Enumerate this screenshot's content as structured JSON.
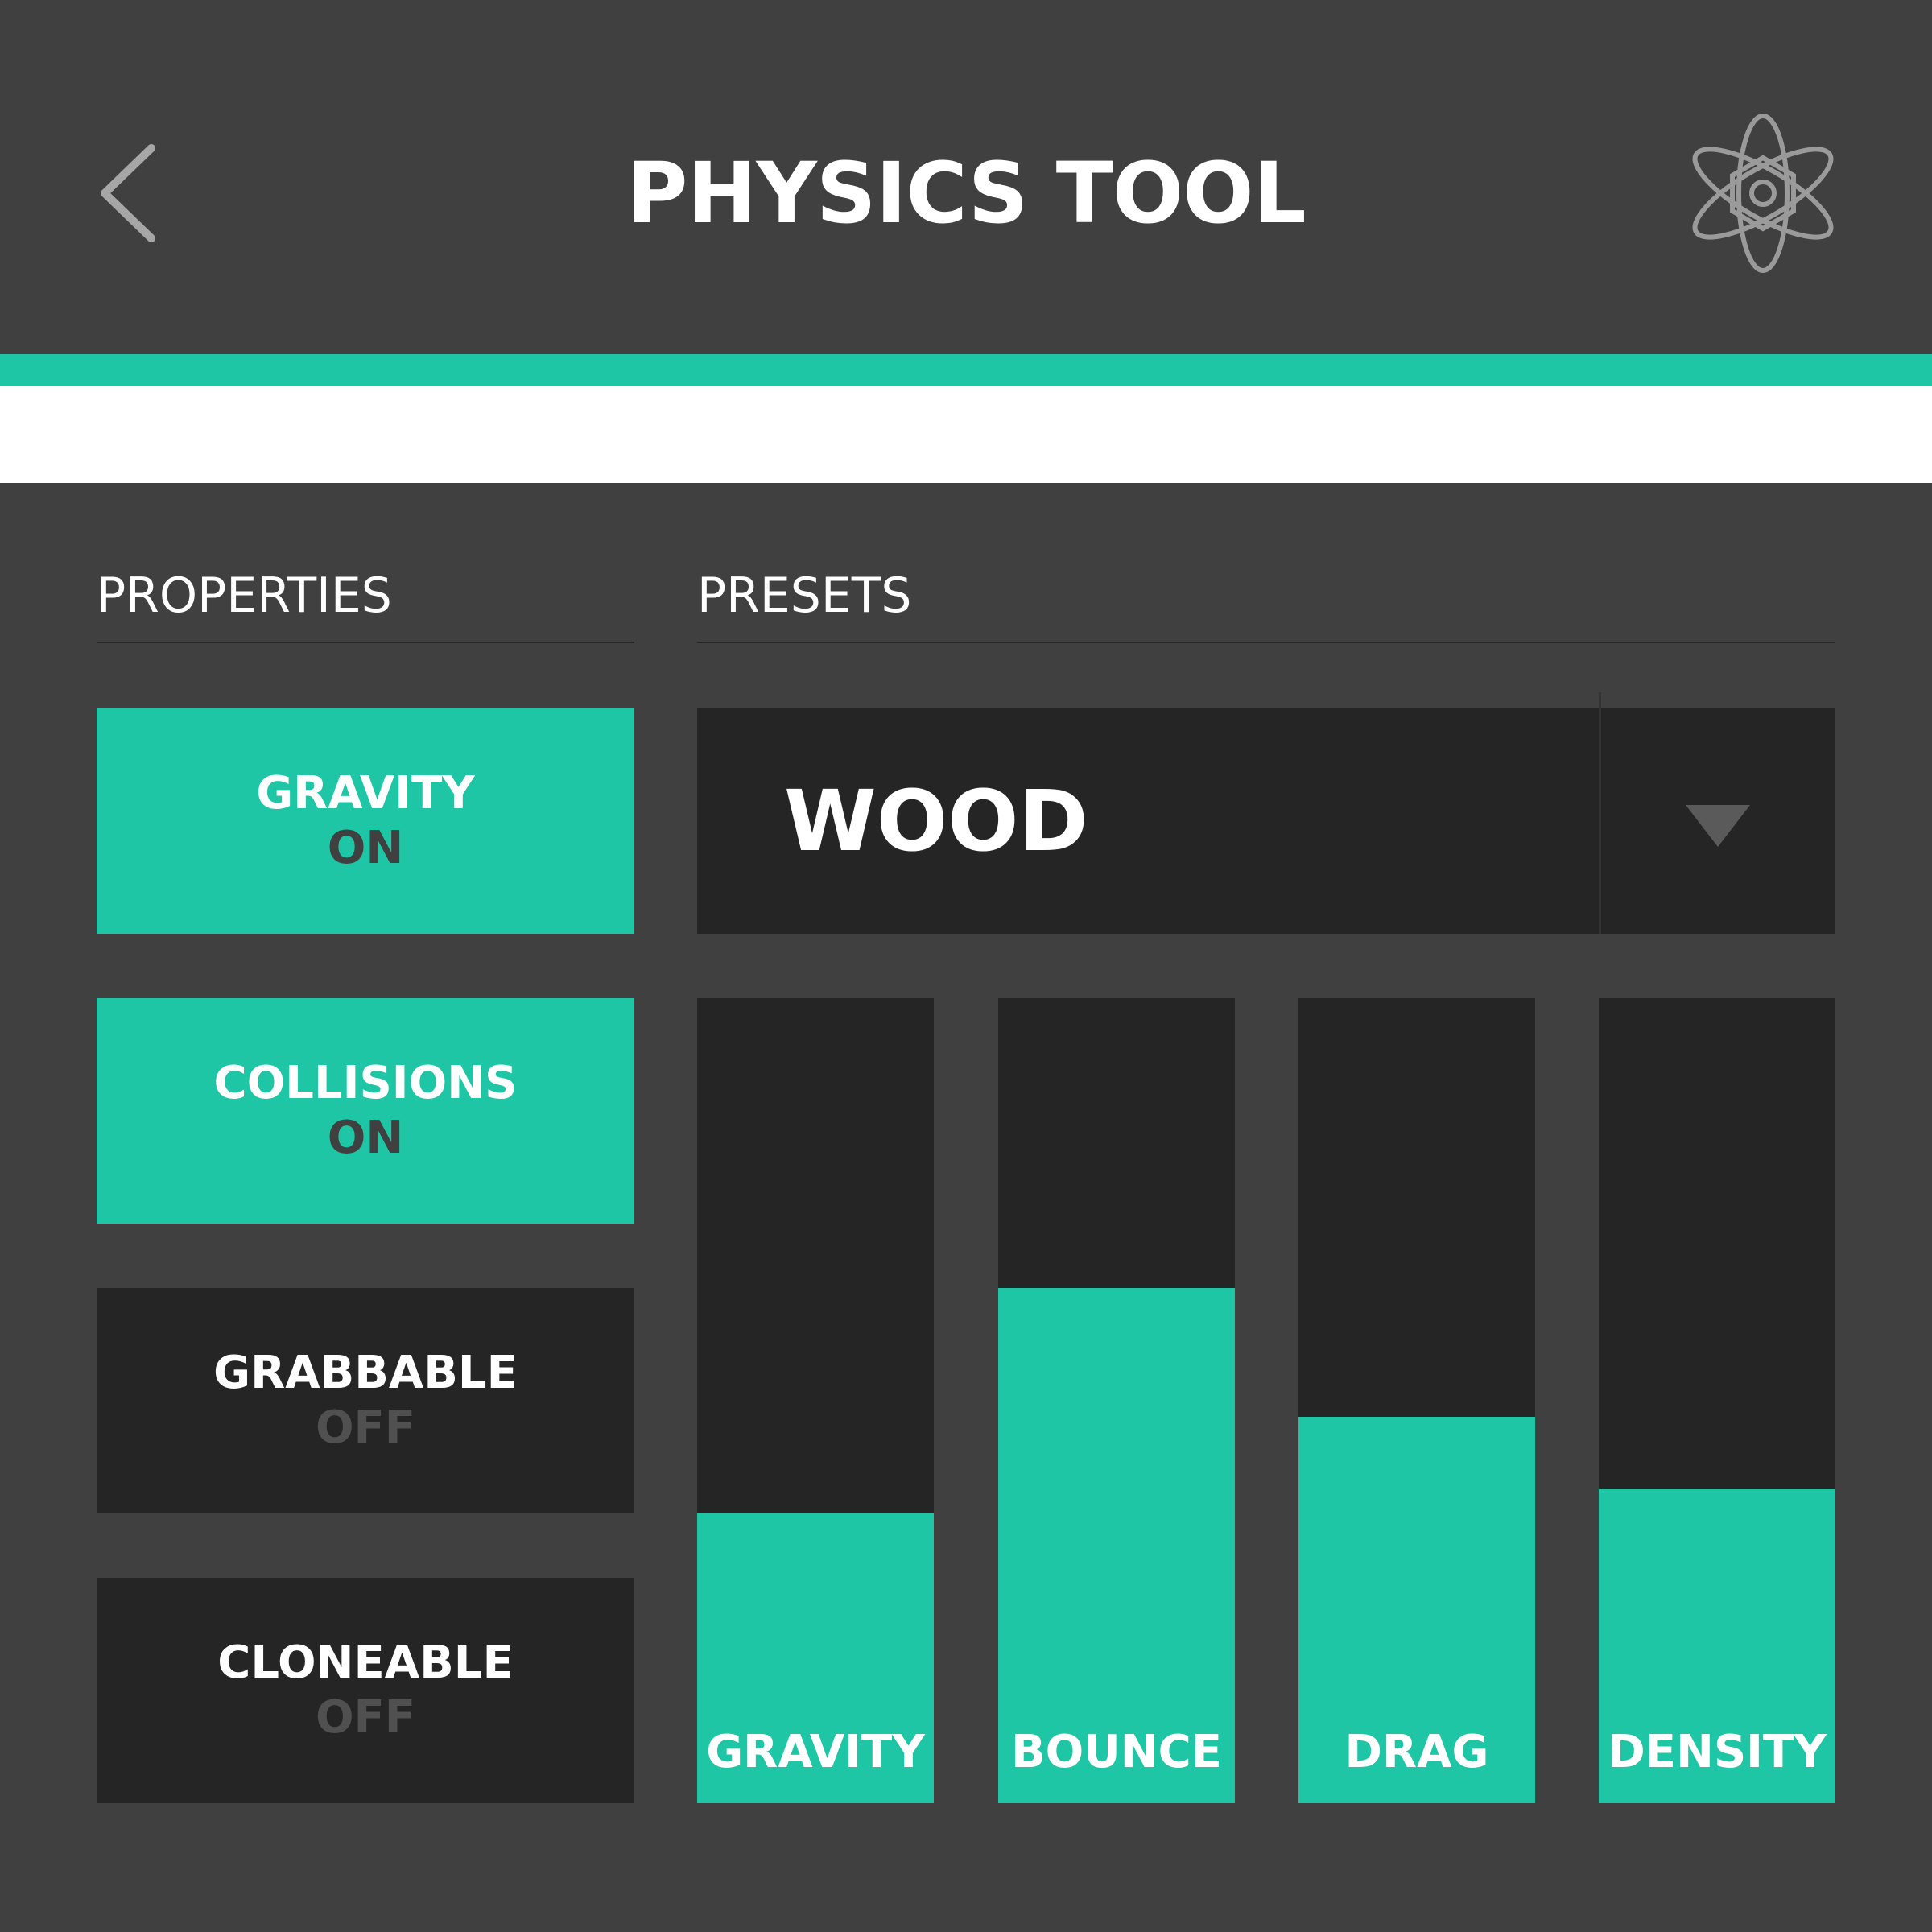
{
  "header": {
    "title": "PHYSICS TOOL",
    "back_icon": "chevron-left-icon",
    "menu_icon": "atom-icon"
  },
  "colors": {
    "accent": "#1fc6a6",
    "header_bg": "#404040",
    "panel_bg": "#404040",
    "dark_tile": "#252525"
  },
  "properties": {
    "heading": "PROPERTIES",
    "toggles": [
      {
        "label": "GRAVITY",
        "state": "ON",
        "on": true
      },
      {
        "label": "COLLISIONS",
        "state": "ON",
        "on": true
      },
      {
        "label": "GRABBABLE",
        "state": "OFF",
        "on": false
      },
      {
        "label": "CLONEABLE",
        "state": "OFF",
        "on": false
      }
    ]
  },
  "presets": {
    "heading": "PRESETS",
    "selected": "WOOD",
    "dropdown_icon": "triangle-down-icon",
    "sliders": [
      {
        "label": "GRAVITY",
        "level": 0.36
      },
      {
        "label": "BOUNCE",
        "level": 0.64
      },
      {
        "label": "DRAG",
        "level": 0.48
      },
      {
        "label": "DENSITY",
        "level": 0.39
      }
    ]
  }
}
